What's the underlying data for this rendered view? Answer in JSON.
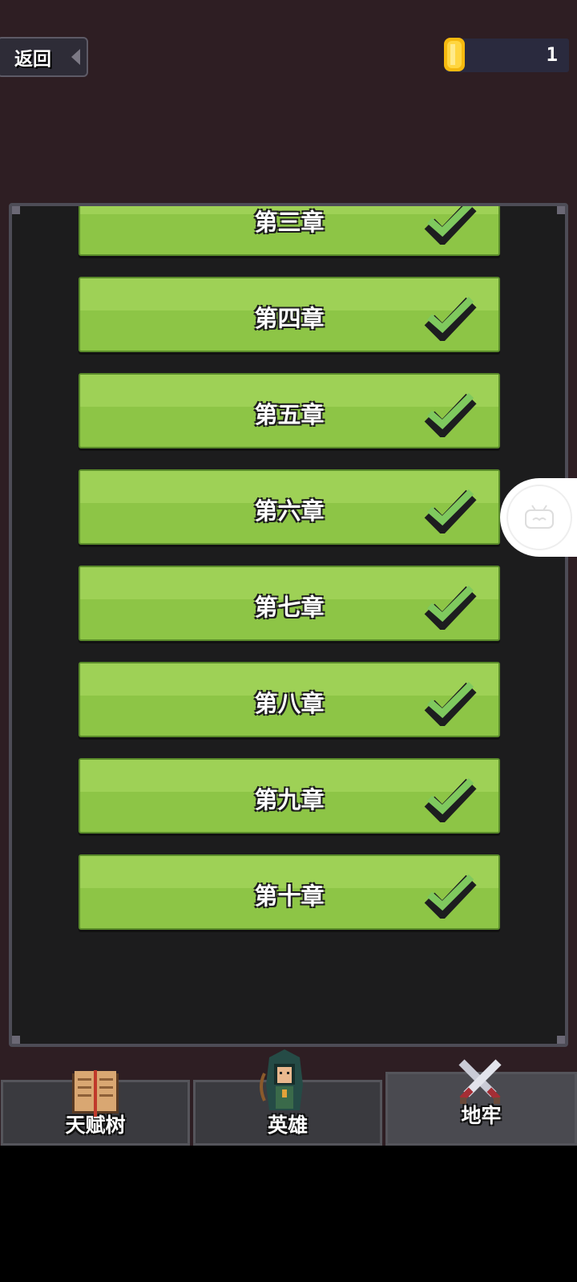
{
  "header": {
    "back_label": "返回",
    "coin_count": "1"
  },
  "chapters": [
    {
      "name": "第三章",
      "completed": true
    },
    {
      "name": "第四章",
      "completed": true
    },
    {
      "name": "第五章",
      "completed": true
    },
    {
      "name": "第六章",
      "completed": true
    },
    {
      "name": "第七章",
      "completed": true
    },
    {
      "name": "第八章",
      "completed": true
    },
    {
      "name": "第九章",
      "completed": true
    },
    {
      "name": "第十章",
      "completed": true
    }
  ],
  "tabs": [
    {
      "label": "天赋树",
      "icon": "book-icon",
      "active": false
    },
    {
      "label": "英雄",
      "icon": "hero-icon",
      "active": false
    },
    {
      "label": "地牢",
      "icon": "crossed-swords-icon",
      "active": true
    }
  ],
  "colors": {
    "background": "#2e1e23",
    "chapter_green": "#8dc546",
    "check_green": "#7fc95e"
  }
}
